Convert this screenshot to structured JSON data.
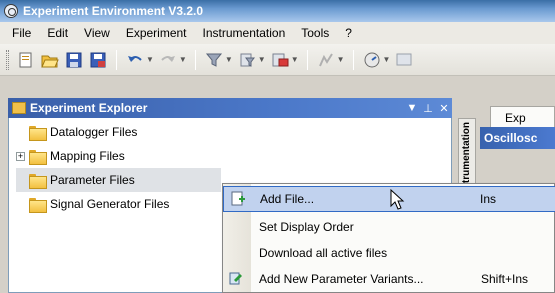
{
  "window": {
    "title": "Experiment Environment V3.2.0"
  },
  "menu": [
    "File",
    "Edit",
    "View",
    "Experiment",
    "Instrumentation",
    "Tools",
    "?"
  ],
  "explorer": {
    "title": "Experiment Explorer",
    "tree": [
      {
        "label": "Datalogger Files",
        "expandable": false
      },
      {
        "label": "Mapping Files",
        "expandable": true,
        "expander": "+"
      },
      {
        "label": "Parameter Files",
        "expandable": false,
        "selected": true
      },
      {
        "label": "Signal Generator Files",
        "expandable": false
      }
    ]
  },
  "right_panel": {
    "vertical_tab": "Instrumentation",
    "tab_label": "Exp",
    "header_label": "Oscillosc"
  },
  "context_menu": {
    "items": [
      {
        "label": "Add File...",
        "shortcut": "Ins",
        "icon": "add-file-icon",
        "highlighted": true
      },
      {
        "label": "Set Display Order",
        "shortcut": "",
        "icon": ""
      },
      {
        "label": "Download all active files",
        "shortcut": "",
        "icon": ""
      },
      {
        "label": "Add New Parameter Variants...",
        "shortcut": "Shift+Ins",
        "icon": "add-variant-icon"
      }
    ]
  },
  "colors": {
    "title_bar": "#3a6ea5",
    "panel_header": "#3a5fa8",
    "menu_highlight": "#c1d2ee",
    "selection": "#dfe2e6"
  }
}
